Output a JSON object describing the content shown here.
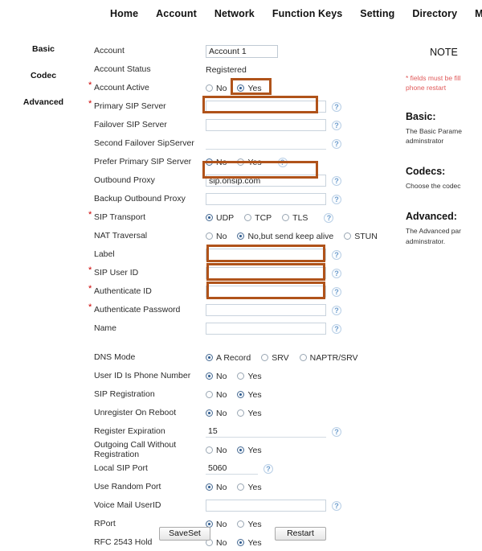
{
  "nav": {
    "items": [
      {
        "label": "Home"
      },
      {
        "label": "Account"
      },
      {
        "label": "Network"
      },
      {
        "label": "Function Keys"
      },
      {
        "label": "Setting"
      },
      {
        "label": "Directory"
      },
      {
        "label": "Manage"
      }
    ]
  },
  "sidebar": {
    "items": [
      {
        "label": "Basic"
      },
      {
        "label": "Codec"
      },
      {
        "label": "Advanced"
      }
    ]
  },
  "main": {
    "title": "Account",
    "account_select": "Account 1",
    "help_icon": "help-question-icon",
    "rows": {
      "account_status": {
        "label": "Account Status",
        "value": "Registered"
      },
      "account_active": {
        "label": "Account Active",
        "options": [
          "No",
          "Yes"
        ],
        "selected": "Yes"
      },
      "primary_sip_server": {
        "label": "Primary SIP Server",
        "value": ""
      },
      "failover_sip_server": {
        "label": "Failover SIP Server",
        "value": ""
      },
      "second_failover_sipserver": {
        "label": "Second Failover SipServer",
        "value": ""
      },
      "prefer_primary_sip_server": {
        "label": "Prefer Primary SIP Server",
        "options": [
          "No",
          "Yes"
        ],
        "selected": "No"
      },
      "outbound_proxy": {
        "label": "Outbound Proxy",
        "value": "sip.onsip.com"
      },
      "backup_outbound_proxy": {
        "label": "Backup Outbound Proxy",
        "value": ""
      },
      "sip_transport": {
        "label": "SIP Transport",
        "options": [
          "UDP",
          "TCP",
          "TLS"
        ],
        "selected": "UDP"
      },
      "nat_traversal": {
        "label": "NAT Traversal",
        "options": [
          "No",
          "No,but send keep alive",
          "STUN"
        ],
        "selected": "No,but send keep alive"
      },
      "label_field": {
        "label": "Label",
        "value": ""
      },
      "sip_user_id": {
        "label": "SIP User ID",
        "value": ""
      },
      "authenticate_id": {
        "label": "Authenticate ID",
        "value": ""
      },
      "authenticate_password": {
        "label": "Authenticate Password",
        "value": ""
      },
      "name": {
        "label": "Name",
        "value": ""
      },
      "dns_mode": {
        "label": "DNS Mode",
        "options": [
          "A Record",
          "SRV",
          "NAPTR/SRV"
        ],
        "selected": "A Record"
      },
      "user_id_is_phone_number": {
        "label": "User ID Is Phone Number",
        "options": [
          "No",
          "Yes"
        ],
        "selected": "No"
      },
      "sip_registration": {
        "label": "SIP Registration",
        "options": [
          "No",
          "Yes"
        ],
        "selected": "Yes"
      },
      "unregister_on_reboot": {
        "label": "Unregister On Reboot",
        "options": [
          "No",
          "Yes"
        ],
        "selected": "No"
      },
      "register_expiration": {
        "label": "Register Expiration",
        "value": "15"
      },
      "outgoing_call_without_registration": {
        "label": "Outgoing Call Without Registration",
        "options": [
          "No",
          "Yes"
        ],
        "selected": "Yes"
      },
      "local_sip_port": {
        "label": "Local SIP Port",
        "value": "5060"
      },
      "use_random_port": {
        "label": "Use Random Port",
        "options": [
          "No",
          "Yes"
        ],
        "selected": "No"
      },
      "voice_mail_userid": {
        "label": "Voice Mail UserID",
        "value": ""
      },
      "rport": {
        "label": "RPort",
        "options": [
          "No",
          "Yes"
        ],
        "selected": "No"
      },
      "rfc_2543_hold": {
        "label": "RFC 2543 Hold",
        "options": [
          "No",
          "Yes"
        ],
        "selected": "Yes"
      }
    }
  },
  "note": {
    "title": "NOTE",
    "warning_line1": "* fields must be fill",
    "warning_line2": "phone restart",
    "basic_heading": "Basic:",
    "basic_body_line1": "The Basic Parame",
    "basic_body_line2": "adminstrator",
    "codecs_heading": "Codecs:",
    "codecs_body_line1": "Choose the codec",
    "advanced_heading": "Advanced:",
    "advanced_body_line1": "The Advanced par",
    "advanced_body_line2": "adminstrator."
  },
  "buttons": {
    "save": "SaveSet",
    "restart": "Restart"
  },
  "colors": {
    "highlight": "#b0531a",
    "required_star": "#cc0000",
    "note_warning": "#e05a5a"
  }
}
